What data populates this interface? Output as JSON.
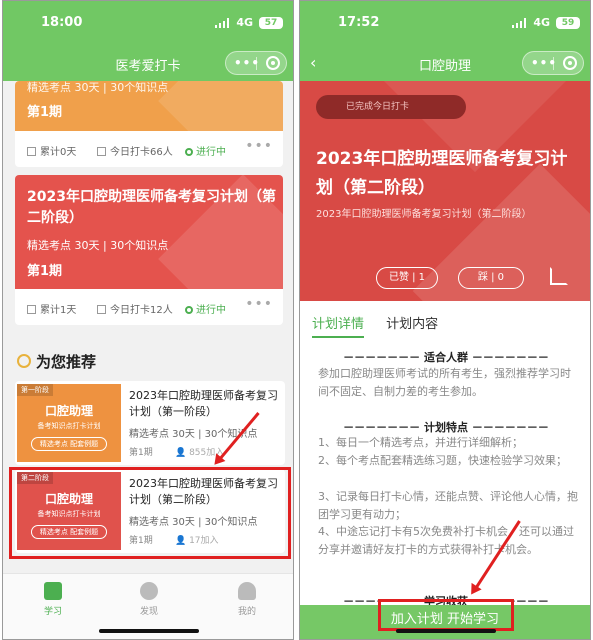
{
  "left": {
    "status": {
      "time": "18:00",
      "network": "4G",
      "battery": "57"
    },
    "nav_title": "医考爱打卡",
    "top_card": {
      "subtitle": "精选考点   30天 | 30个知识点",
      "phase": "第1期",
      "total": "累计0天",
      "today": "今日打卡66人",
      "state": "进行中"
    },
    "second_card": {
      "title": "2023年口腔助理医师备考复习计划（第二阶段）",
      "subtitle": "精选考点   30天 | 30个知识点",
      "phase": "第1期",
      "total": "累计1天",
      "today": "今日打卡12人",
      "state": "进行中"
    },
    "rec_heading": "为您推荐",
    "recommendations": [
      {
        "tag": "第一阶段",
        "thumb_title": "口腔助理",
        "thumb_sub": "备考知识点打卡计划",
        "thumb_btn": "精选考点   配套例题",
        "title": "2023年口腔助理医师备考复习计划（第一阶段）",
        "meta": "精选考点   30天 | 30个知识点",
        "phase": "第1期",
        "joined": "855加入"
      },
      {
        "tag": "第二阶段",
        "thumb_title": "口腔助理",
        "thumb_sub": "备考知识点打卡计划",
        "thumb_btn": "精选考点   配套例题",
        "title": "2023年口腔助理医师备考复习计划（第二阶段）",
        "meta": "精选考点   30天 | 30个知识点",
        "phase": "第1期",
        "joined": "17加入"
      }
    ],
    "tabs": [
      "学习",
      "发现",
      "我的"
    ]
  },
  "right": {
    "status": {
      "time": "17:52",
      "network": "4G",
      "battery": "59"
    },
    "nav_title": "口腔助理",
    "done_pill": "已完成今日打卡",
    "hero_title": "2023年口腔助理医师备考复习计划（第二阶段）",
    "hero_sub": "2023年口腔助理医师备考复习计划（第二阶段）",
    "liked": "已赞 | 1",
    "stepped": "踩 | 0",
    "tabs": [
      "计划详情",
      "计划内容"
    ],
    "sec1_head": "－－－－－－－  适合人群  －－－－－－－",
    "sec1_body": "参加口腔助理医师考试的所有考生，强烈推荐学习时间不固定、自制力差的考生参加。",
    "sec2_head": "－－－－－－－  计划特点  －－－－－－－",
    "sec2_items": [
      "1、每日一个精选考点，并进行详细解析；",
      "2、每个考点配套精选练习题，快速检验学习效果；",
      "3、记录每日打卡心情，还能点赞、评论他人心情，抱团学习更有动力；",
      "4、中途忘记打卡有5次免费补打卡机会，还可以通过分享并邀请好友打卡的方式获得补打卡机会。"
    ],
    "sec3_head": "－－－－－－－  学习收获  －－－－－－－",
    "cta": "加入计划 开始学习"
  },
  "colors": {
    "green": "#71c864",
    "red": "#d84a45",
    "orange": "#f0a04b",
    "highlight": "#e02020"
  }
}
